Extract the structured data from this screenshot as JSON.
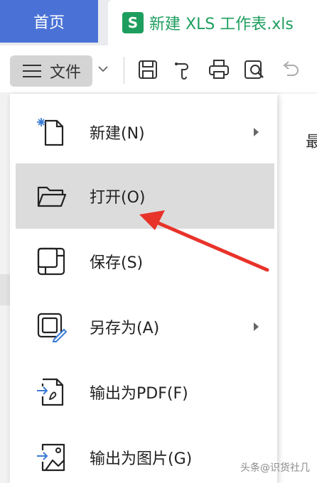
{
  "tabs": {
    "home_label": "首页",
    "document_icon_letter": "S",
    "document_title": "新建 XLS 工作表.xls"
  },
  "toolbar": {
    "file_label": "文件",
    "icons": [
      "save-icon",
      "format-painter-icon",
      "print-icon",
      "print-preview-icon",
      "undo-icon"
    ]
  },
  "menu": {
    "items": [
      {
        "label": "新建(N)",
        "icon": "new-file-icon",
        "has_submenu": true
      },
      {
        "label": "打开(O)",
        "icon": "open-folder-icon",
        "has_submenu": false,
        "highlighted": true
      },
      {
        "label": "保存(S)",
        "icon": "save-icon",
        "has_submenu": false
      },
      {
        "label": "另存为(A)",
        "icon": "save-as-icon",
        "has_submenu": true
      },
      {
        "label": "输出为PDF(F)",
        "icon": "export-pdf-icon",
        "has_submenu": false
      },
      {
        "label": "输出为图片(G)",
        "icon": "export-image-icon",
        "has_submenu": false
      }
    ]
  },
  "right_panel": {
    "partial_text": "最"
  },
  "watermark": "头条@识货社几",
  "colors": {
    "accent": "#4a72d6",
    "sheet_green": "#1e9e5e",
    "annotation_arrow": "#e8332a",
    "hover_bg": "#dcdcdc"
  }
}
